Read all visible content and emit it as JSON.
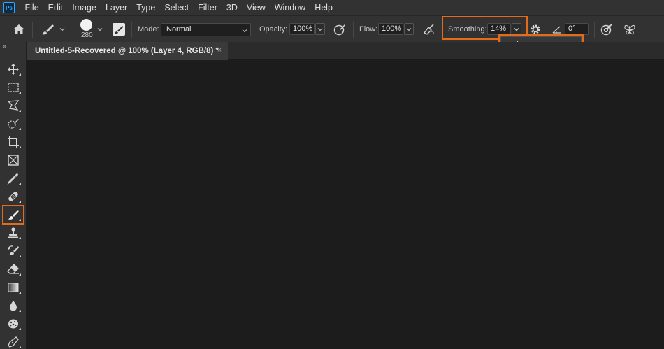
{
  "menu": [
    "File",
    "Edit",
    "Image",
    "Layer",
    "Type",
    "Select",
    "Filter",
    "3D",
    "View",
    "Window",
    "Help"
  ],
  "logo_text": "Ps",
  "options": {
    "brush_size": "280",
    "mode_label": "Mode:",
    "mode_value": "Normal",
    "opacity_label": "Opacity:",
    "opacity_value": "100%",
    "flow_label": "Flow:",
    "flow_value": "100%",
    "smoothing_label": "Smoothing:",
    "smoothing_value": "14%",
    "angle_value": "0°"
  },
  "smoothing_slider": {
    "value": 14,
    "max": 100
  },
  "document_tab": {
    "title": "Untitled-5-Recovered @ 100% (Layer 4, RGB/8) *",
    "close_symbol": "×"
  },
  "toolbox": {
    "collapse_symbol": "››",
    "tools": [
      "move-tool",
      "marquee-tool",
      "lasso-tool",
      "quick-selection-tool",
      "crop-tool",
      "frame-tool",
      "eyedropper-tool",
      "healing-brush-tool",
      "brush-tool",
      "clone-stamp-tool",
      "history-brush-tool",
      "eraser-tool",
      "gradient-tool",
      "blur-tool",
      "sponge-tool",
      "pen-tool"
    ],
    "active_tool": "brush-tool"
  },
  "colors": {
    "highlight": "#e36b1a",
    "accent": "#31a8ff",
    "panel": "#323232",
    "canvas": "#1c1c1c"
  }
}
